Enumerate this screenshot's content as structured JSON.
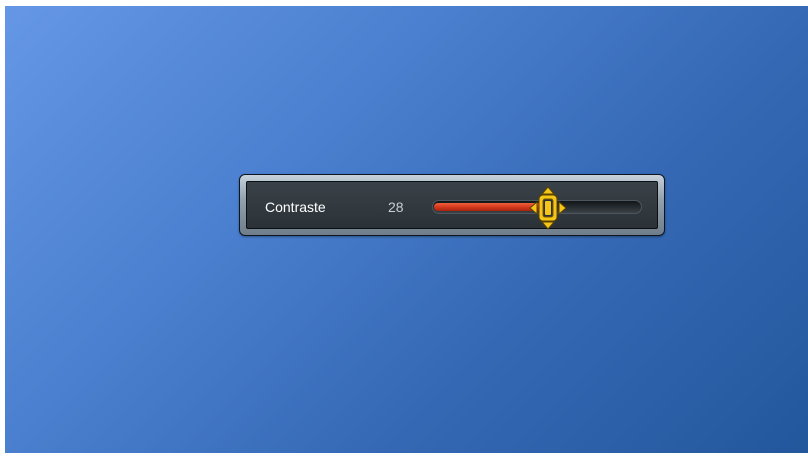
{
  "osd": {
    "setting_label": "Contraste",
    "value_text": "28",
    "slider_level": 0.55
  },
  "colors": {
    "background_start": "#6597e6",
    "background_end": "#23579c",
    "fill": "#d43a1e",
    "thumb": "#f5c518"
  },
  "icons": {
    "thumb": "slider-thumb-arrows-icon"
  }
}
